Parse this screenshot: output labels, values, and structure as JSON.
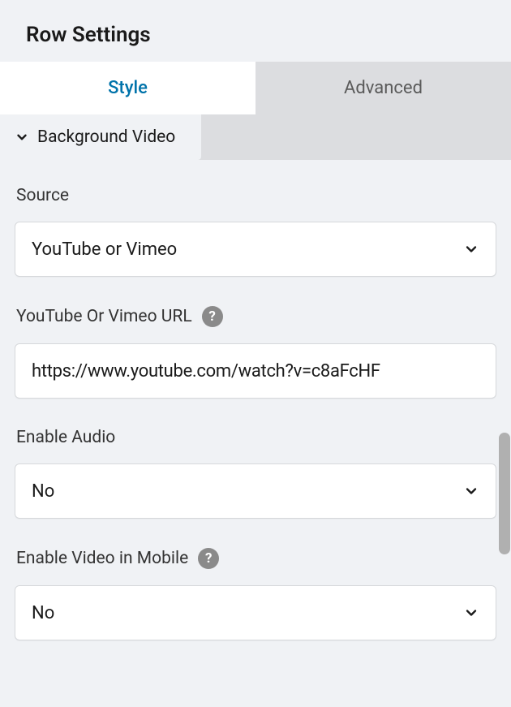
{
  "header": {
    "title": "Row Settings"
  },
  "tabs": {
    "style": "Style",
    "advanced": "Advanced"
  },
  "section": {
    "title": "Background Video"
  },
  "fields": {
    "source": {
      "label": "Source",
      "value": "YouTube or Vimeo"
    },
    "url": {
      "label": "YouTube Or Vimeo URL",
      "value": "https://www.youtube.com/watch?v=c8aFcHF"
    },
    "enableAudio": {
      "label": "Enable Audio",
      "value": "No"
    },
    "enableVideoMobile": {
      "label": "Enable Video in Mobile",
      "value": "No"
    }
  },
  "icons": {
    "help": "?"
  }
}
